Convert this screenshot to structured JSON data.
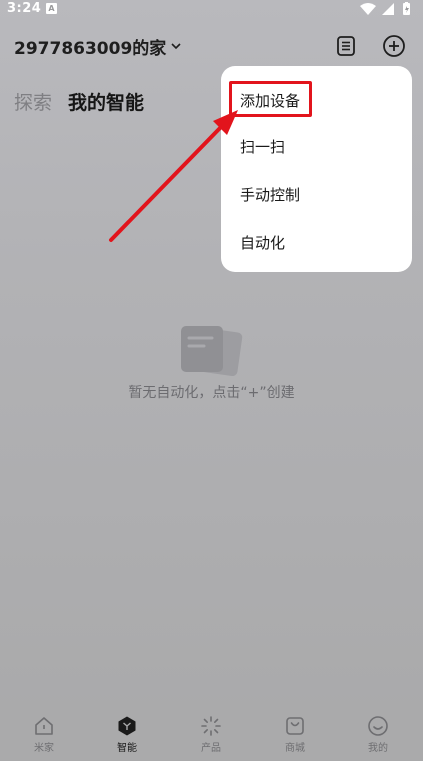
{
  "status_bar": {
    "time": "3:24",
    "notification_glyph": "A",
    "icons": [
      "wifi-icon",
      "signal-icon",
      "battery-icon"
    ]
  },
  "header": {
    "home_name": "2977863009的家",
    "icons": [
      "chevron-down-icon",
      "log-list-icon",
      "add-circle-icon"
    ]
  },
  "tabs": [
    {
      "label": "探索",
      "active": false
    },
    {
      "label": "我的智能",
      "active": true
    }
  ],
  "empty_state": {
    "icon": "empty-document-icon",
    "text": "暂无自动化，点击“+”创建"
  },
  "dropdown_menu": {
    "items": [
      {
        "label": "添加设备",
        "highlighted": true
      },
      {
        "label": "扫一扫",
        "highlighted": false
      },
      {
        "label": "手动控制",
        "highlighted": false
      },
      {
        "label": "自动化",
        "highlighted": false
      }
    ],
    "highlight_color": "#e2141c"
  },
  "bottom_nav": {
    "items": [
      {
        "label": "米家",
        "icon": "home-icon",
        "active": false
      },
      {
        "label": "智能",
        "icon": "smart-cube-icon",
        "active": true
      },
      {
        "label": "产品",
        "icon": "product-sparkle-icon",
        "active": false
      },
      {
        "label": "商城",
        "icon": "shopping-bag-icon",
        "active": false
      },
      {
        "label": "我的",
        "icon": "profile-smile-icon",
        "active": false
      }
    ]
  }
}
